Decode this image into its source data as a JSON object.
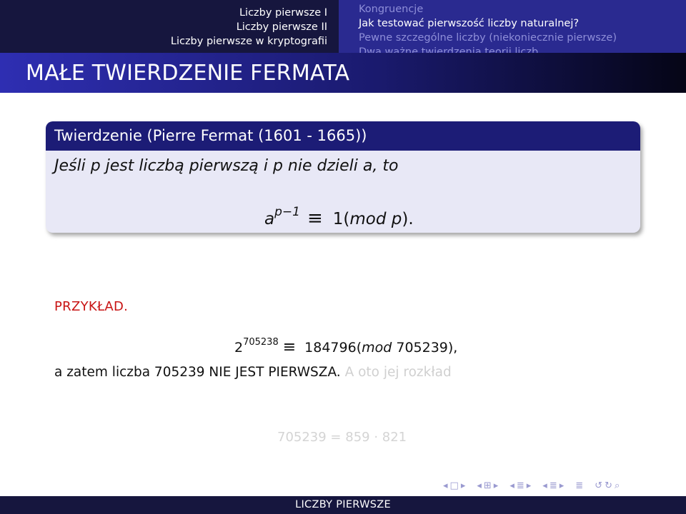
{
  "header": {
    "sections": [
      {
        "label": "Liczby pierwsze I"
      },
      {
        "label": "Liczby pierwsze II"
      },
      {
        "label": "Liczby pierwsze w kryptografii"
      }
    ],
    "subsections": [
      {
        "label": "Kongruencje"
      },
      {
        "label": "Jak testować pierwszość liczby naturalnej?"
      },
      {
        "label": "Pewne szczególne liczby (niekoniecznie pierwsze)"
      },
      {
        "label": "Dwa ważne twierdzenia teorii liczb"
      }
    ]
  },
  "frame_title": "MAŁE TWIERDZENIE FERMATA",
  "theorem": {
    "title": "Twierdzenie (Pierre Fermat (1601 - 1665))",
    "statement": "Jeśli p jest liczbą pierwszą i p nie dzieli a, to",
    "formula": {
      "base": "a",
      "exponent": "p−1",
      "equiv": "≡",
      "rhs_value": "1(",
      "mod_word": "mod",
      "mod_var": " p",
      "tail": ")."
    }
  },
  "example": {
    "heading": "PRZYKŁAD.",
    "formula": {
      "base": "2",
      "exponent": "705238",
      "equiv": "≡",
      "rhs_value": "184796(",
      "mod_word": "mod",
      "modulus": " 705239),"
    },
    "conclusion": "a zatem liczba 705239 NIE JEST PIERWSZA.",
    "conclusion_faded": " A oto jej rozkład",
    "factorization": "705239 = 859 · 821"
  },
  "navigation": {
    "symbols": [
      "◂",
      "□",
      "▸",
      "◂",
      "⊞",
      "▸",
      "◂",
      "≣",
      "▸",
      "◂",
      "≣",
      "▸",
      "≣",
      "↺",
      "↻",
      "⌕"
    ],
    "color": "#9a9ad0"
  },
  "footer": "LICZBY PIERWSZE",
  "colors": {
    "header_left_bg": "#16163e",
    "header_right_bg": "#2a2a90",
    "block_header_bg": "#1c1c76",
    "block_body_bg": "#e8e8f6",
    "example_heading": "#c81414"
  }
}
